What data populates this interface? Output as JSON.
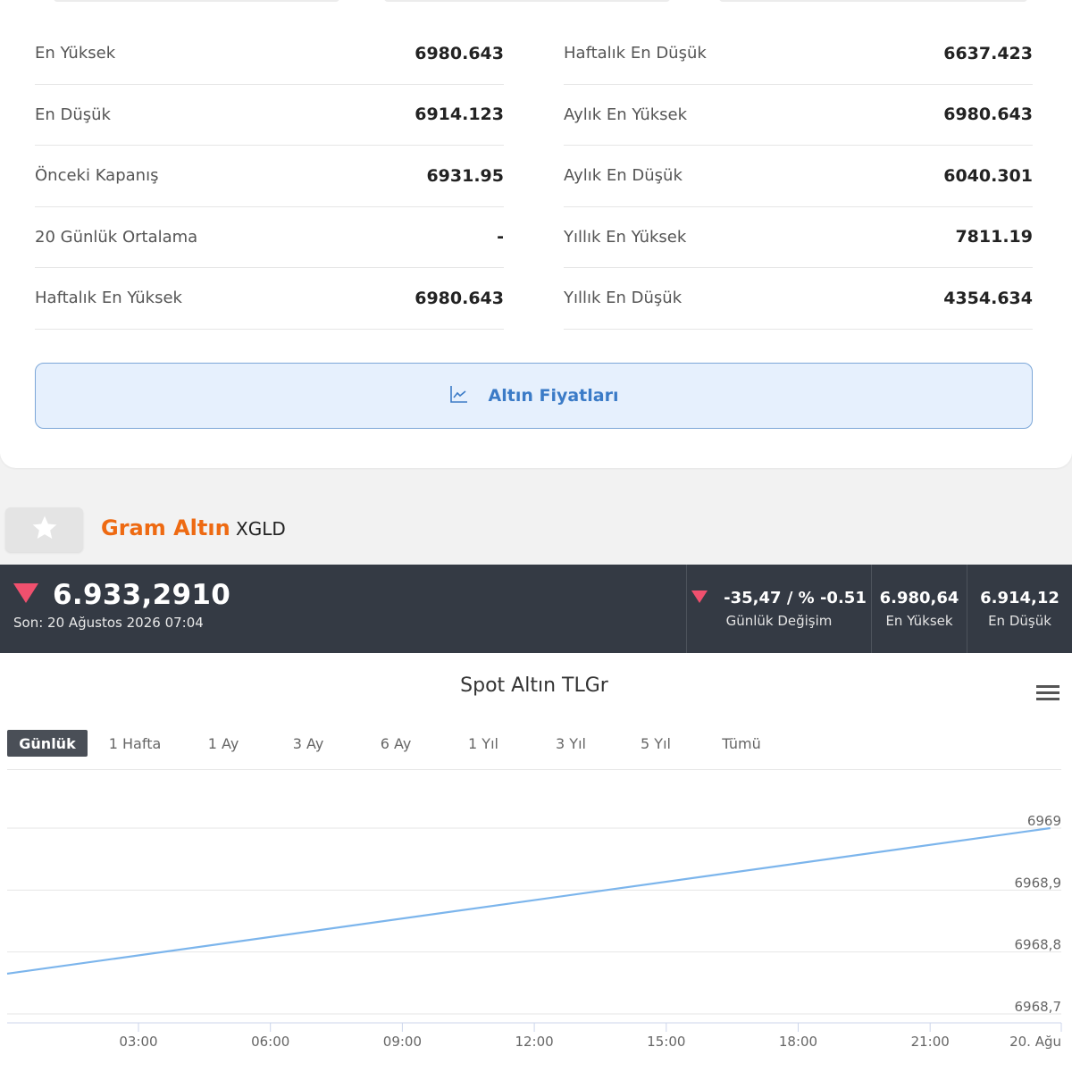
{
  "stats": {
    "left": [
      {
        "label": "En Yüksek",
        "value": "6980.643"
      },
      {
        "label": "En Düşük",
        "value": "6914.123"
      },
      {
        "label": "Önceki Kapanış",
        "value": "6931.95"
      },
      {
        "label": "20 Günlük Ortalama",
        "value": "-"
      },
      {
        "label": "Haftalık En Yüksek",
        "value": "6980.643"
      }
    ],
    "right": [
      {
        "label": "Haftalık En Düşük",
        "value": "6637.423"
      },
      {
        "label": "Aylık En Yüksek",
        "value": "6980.643"
      },
      {
        "label": "Aylık En Düşük",
        "value": "6040.301"
      },
      {
        "label": "Yıllık En Yüksek",
        "value": "7811.19"
      },
      {
        "label": "Yıllık En Düşük",
        "value": "4354.634"
      }
    ]
  },
  "chart_button": {
    "label": "Altın Fiyatları",
    "icon": "line-chart-icon"
  },
  "asset": {
    "name": "Gram Altın",
    "code": "XGLD"
  },
  "price": {
    "value": "6.933,2910",
    "last_update": "Son: 20 Ağustos 2026 07:04",
    "direction": "down",
    "daily_change": "-35,47 / % -0.51",
    "daily_change_label": "Günlük Değişim",
    "high": "6.980,64",
    "high_label": "En Yüksek",
    "low": "6.914,12",
    "low_label": "En Düşük"
  },
  "colors": {
    "accent": "#ee6a12",
    "down": "#f0506e",
    "dark_bar": "#343a44",
    "line": "#7cb5ec",
    "button_text": "#3b7bc7"
  },
  "range_buttons": [
    "Günlük",
    "1 Hafta",
    "1 Ay",
    "3 Ay",
    "6 Ay",
    "1 Yıl",
    "3 Yıl",
    "5 Yıl",
    "Tümü"
  ],
  "active_range": "Günlük",
  "chart_data": {
    "type": "line",
    "title": "Spot Altın TLGr",
    "x_ticks": [
      "03:00",
      "06:00",
      "09:00",
      "12:00",
      "15:00",
      "18:00",
      "21:00",
      "20. Ağu"
    ],
    "y_ticks": [
      "6969",
      "6968,9",
      "6968,8",
      "6968,7"
    ],
    "ylim": [
      6968.7,
      6969.0
    ],
    "grid": true,
    "legend": "none",
    "series": [
      {
        "x": [
          "00:00",
          "23:45"
        ],
        "y": [
          6968.765,
          6969.0
        ]
      }
    ]
  }
}
